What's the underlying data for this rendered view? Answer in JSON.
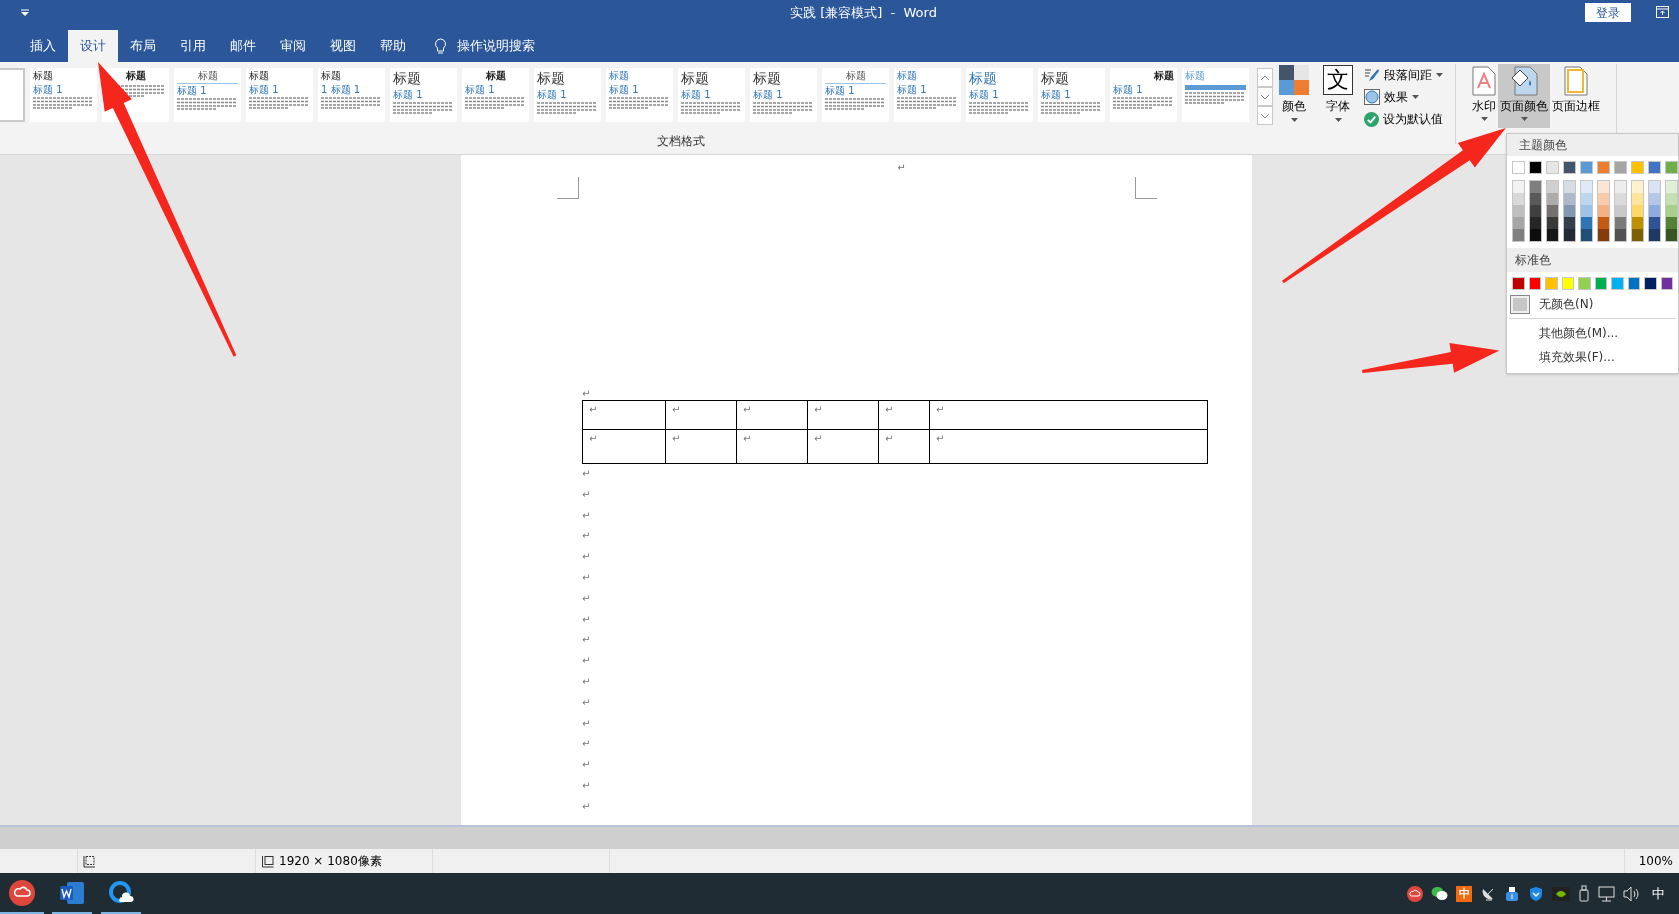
{
  "title_bar": {
    "title": "实践 [兼容模式]  -  Word",
    "login_button": "登录"
  },
  "tabs": [
    {
      "label": "插入",
      "selected": false
    },
    {
      "label": "设计",
      "selected": true
    },
    {
      "label": "布局",
      "selected": false
    },
    {
      "label": "引用",
      "selected": false
    },
    {
      "label": "邮件",
      "selected": false
    },
    {
      "label": "审阅",
      "selected": false
    },
    {
      "label": "视图",
      "selected": false
    },
    {
      "label": "帮助",
      "selected": false
    }
  ],
  "tell_me": {
    "label": "操作说明搜索"
  },
  "style_gallery": {
    "label": "文档格式",
    "thumbnails": [
      {
        "title": "标题",
        "subtitle": "标题 1",
        "kind": "plain"
      },
      {
        "title": "标题",
        "kind": "small-bold"
      },
      {
        "title": "标题",
        "subtitle": "标题 1",
        "kind": "underlined"
      },
      {
        "title": "标题",
        "subtitle": "标题 1",
        "kind": "plain"
      },
      {
        "title": "标题",
        "subtitle": "1  标题 1",
        "kind": "plain"
      },
      {
        "title": "标题",
        "subtitle": "标题 1",
        "kind": "large"
      },
      {
        "title": "标题",
        "subtitle": "标题 1",
        "kind": "small-bold"
      },
      {
        "title": "标题",
        "subtitle": "标题 1",
        "kind": "large"
      },
      {
        "title": "标题",
        "subtitle": "标题 1",
        "kind": "blue"
      },
      {
        "title": "标题",
        "subtitle": "标题 1",
        "kind": "large"
      },
      {
        "title": "标题",
        "subtitle": "标题 1",
        "kind": "large"
      },
      {
        "title": "标题",
        "subtitle": "标题 1",
        "kind": "underlined"
      },
      {
        "title": "标题",
        "subtitle": "标题 1",
        "kind": "blue"
      },
      {
        "title": "标题",
        "subtitle": "标题 1",
        "kind": "blue-large"
      },
      {
        "title": "标题",
        "subtitle": "标题 1",
        "kind": "large"
      },
      {
        "title": "标题",
        "subtitle": "标题 1",
        "kind": "right"
      },
      {
        "title": "标题",
        "kind": "banner"
      }
    ]
  },
  "document_formatting": {
    "colors_button": "颜色",
    "fonts_button": {
      "glyph": "文",
      "label": "字体"
    },
    "options": [
      {
        "label": "段落间距",
        "kind": "spacing"
      },
      {
        "label": "效果",
        "kind": "effects"
      },
      {
        "label": "设为默认值",
        "kind": "default"
      }
    ]
  },
  "page_background": {
    "buttons": [
      {
        "label": "水印",
        "kind": "watermark",
        "selected": false
      },
      {
        "label": "页面颜色",
        "kind": "page-color",
        "selected": true
      },
      {
        "label": "页面边框",
        "kind": "page-border",
        "selected": false
      }
    ]
  },
  "page_color_menu": {
    "theme_header": "主题颜色",
    "theme_colors": [
      {
        "color": "#ffffff",
        "shades": [
          {
            "color": "#f2f2f2"
          },
          {
            "color": "#d9d9d9"
          },
          {
            "color": "#bfbfbf"
          },
          {
            "color": "#a6a6a6"
          },
          {
            "color": "#808080"
          }
        ]
      },
      {
        "color": "#000000",
        "shades": [
          {
            "color": "#7f7f7f"
          },
          {
            "color": "#595959"
          },
          {
            "color": "#404040"
          },
          {
            "color": "#262626"
          },
          {
            "color": "#0d0d0d"
          }
        ]
      },
      {
        "color": "#e7e6e6",
        "shades": [
          {
            "color": "#d0cece"
          },
          {
            "color": "#aeabab"
          },
          {
            "color": "#757171"
          },
          {
            "color": "#3a3838"
          },
          {
            "color": "#171616"
          }
        ]
      },
      {
        "color": "#44546a",
        "shades": [
          {
            "color": "#d6dce4"
          },
          {
            "color": "#adb9ca"
          },
          {
            "color": "#8497b0"
          },
          {
            "color": "#333f4f"
          },
          {
            "color": "#222a35"
          }
        ]
      },
      {
        "color": "#5b9bd5",
        "shades": [
          {
            "color": "#deebf6"
          },
          {
            "color": "#bdd7ee"
          },
          {
            "color": "#9dc3e6"
          },
          {
            "color": "#2e75b5"
          },
          {
            "color": "#1f4e79"
          }
        ]
      },
      {
        "color": "#ed7d31",
        "shades": [
          {
            "color": "#fbe5d5"
          },
          {
            "color": "#f7cbac"
          },
          {
            "color": "#f4b183"
          },
          {
            "color": "#c55a11"
          },
          {
            "color": "#843c0b"
          }
        ]
      },
      {
        "color": "#a5a5a5",
        "shades": [
          {
            "color": "#ededed"
          },
          {
            "color": "#dbdbdb"
          },
          {
            "color": "#c9c9c9"
          },
          {
            "color": "#7b7b7b"
          },
          {
            "color": "#525252"
          }
        ]
      },
      {
        "color": "#ffc000",
        "shades": [
          {
            "color": "#fff2cc"
          },
          {
            "color": "#fee599"
          },
          {
            "color": "#ffd965"
          },
          {
            "color": "#bf9000"
          },
          {
            "color": "#7f6000"
          }
        ]
      },
      {
        "color": "#4472c4",
        "shades": [
          {
            "color": "#dae3f3"
          },
          {
            "color": "#b4c7e7"
          },
          {
            "color": "#8faadc"
          },
          {
            "color": "#2f5496"
          },
          {
            "color": "#1f3864"
          }
        ]
      },
      {
        "color": "#70ad47",
        "shades": [
          {
            "color": "#e2efd9"
          },
          {
            "color": "#c5e0b3"
          },
          {
            "color": "#a8d08d"
          },
          {
            "color": "#538135"
          },
          {
            "color": "#375623"
          }
        ]
      }
    ],
    "standard_header": "标准色",
    "standard_colors": [
      {
        "color": "#c00000"
      },
      {
        "color": "#ff0000"
      },
      {
        "color": "#ffc000"
      },
      {
        "color": "#ffff00"
      },
      {
        "color": "#92d050"
      },
      {
        "color": "#00b050"
      },
      {
        "color": "#00b0f0"
      },
      {
        "color": "#0070c0"
      },
      {
        "color": "#002060"
      },
      {
        "color": "#7030a0"
      }
    ],
    "no_color": "无颜色(N)",
    "more_colors": "其他颜色(M)...",
    "fill_effects": "填充效果(F)..."
  },
  "document": {
    "header_mark": "↵",
    "paragraphs_before": [
      "↵"
    ],
    "table": {
      "rows": [
        [
          "↵",
          "↵",
          "↵",
          "↵",
          "↵",
          "↵"
        ],
        [
          "↵",
          "↵",
          "↵",
          "↵",
          "↵",
          "↵"
        ]
      ]
    },
    "paragraphs_after": [
      "↵",
      "↵",
      "↵",
      "↵",
      "↵",
      "↵",
      "↵",
      "↵",
      "↵",
      "↵",
      "↵",
      "↵",
      "↵",
      "↵",
      "↵",
      "↵",
      "↵"
    ]
  },
  "status_bar": {
    "dimensions": "1920 × 1080像素",
    "zoom": "100%"
  },
  "taskbar": {
    "tray_badge": "中",
    "input_method": "中"
  }
}
